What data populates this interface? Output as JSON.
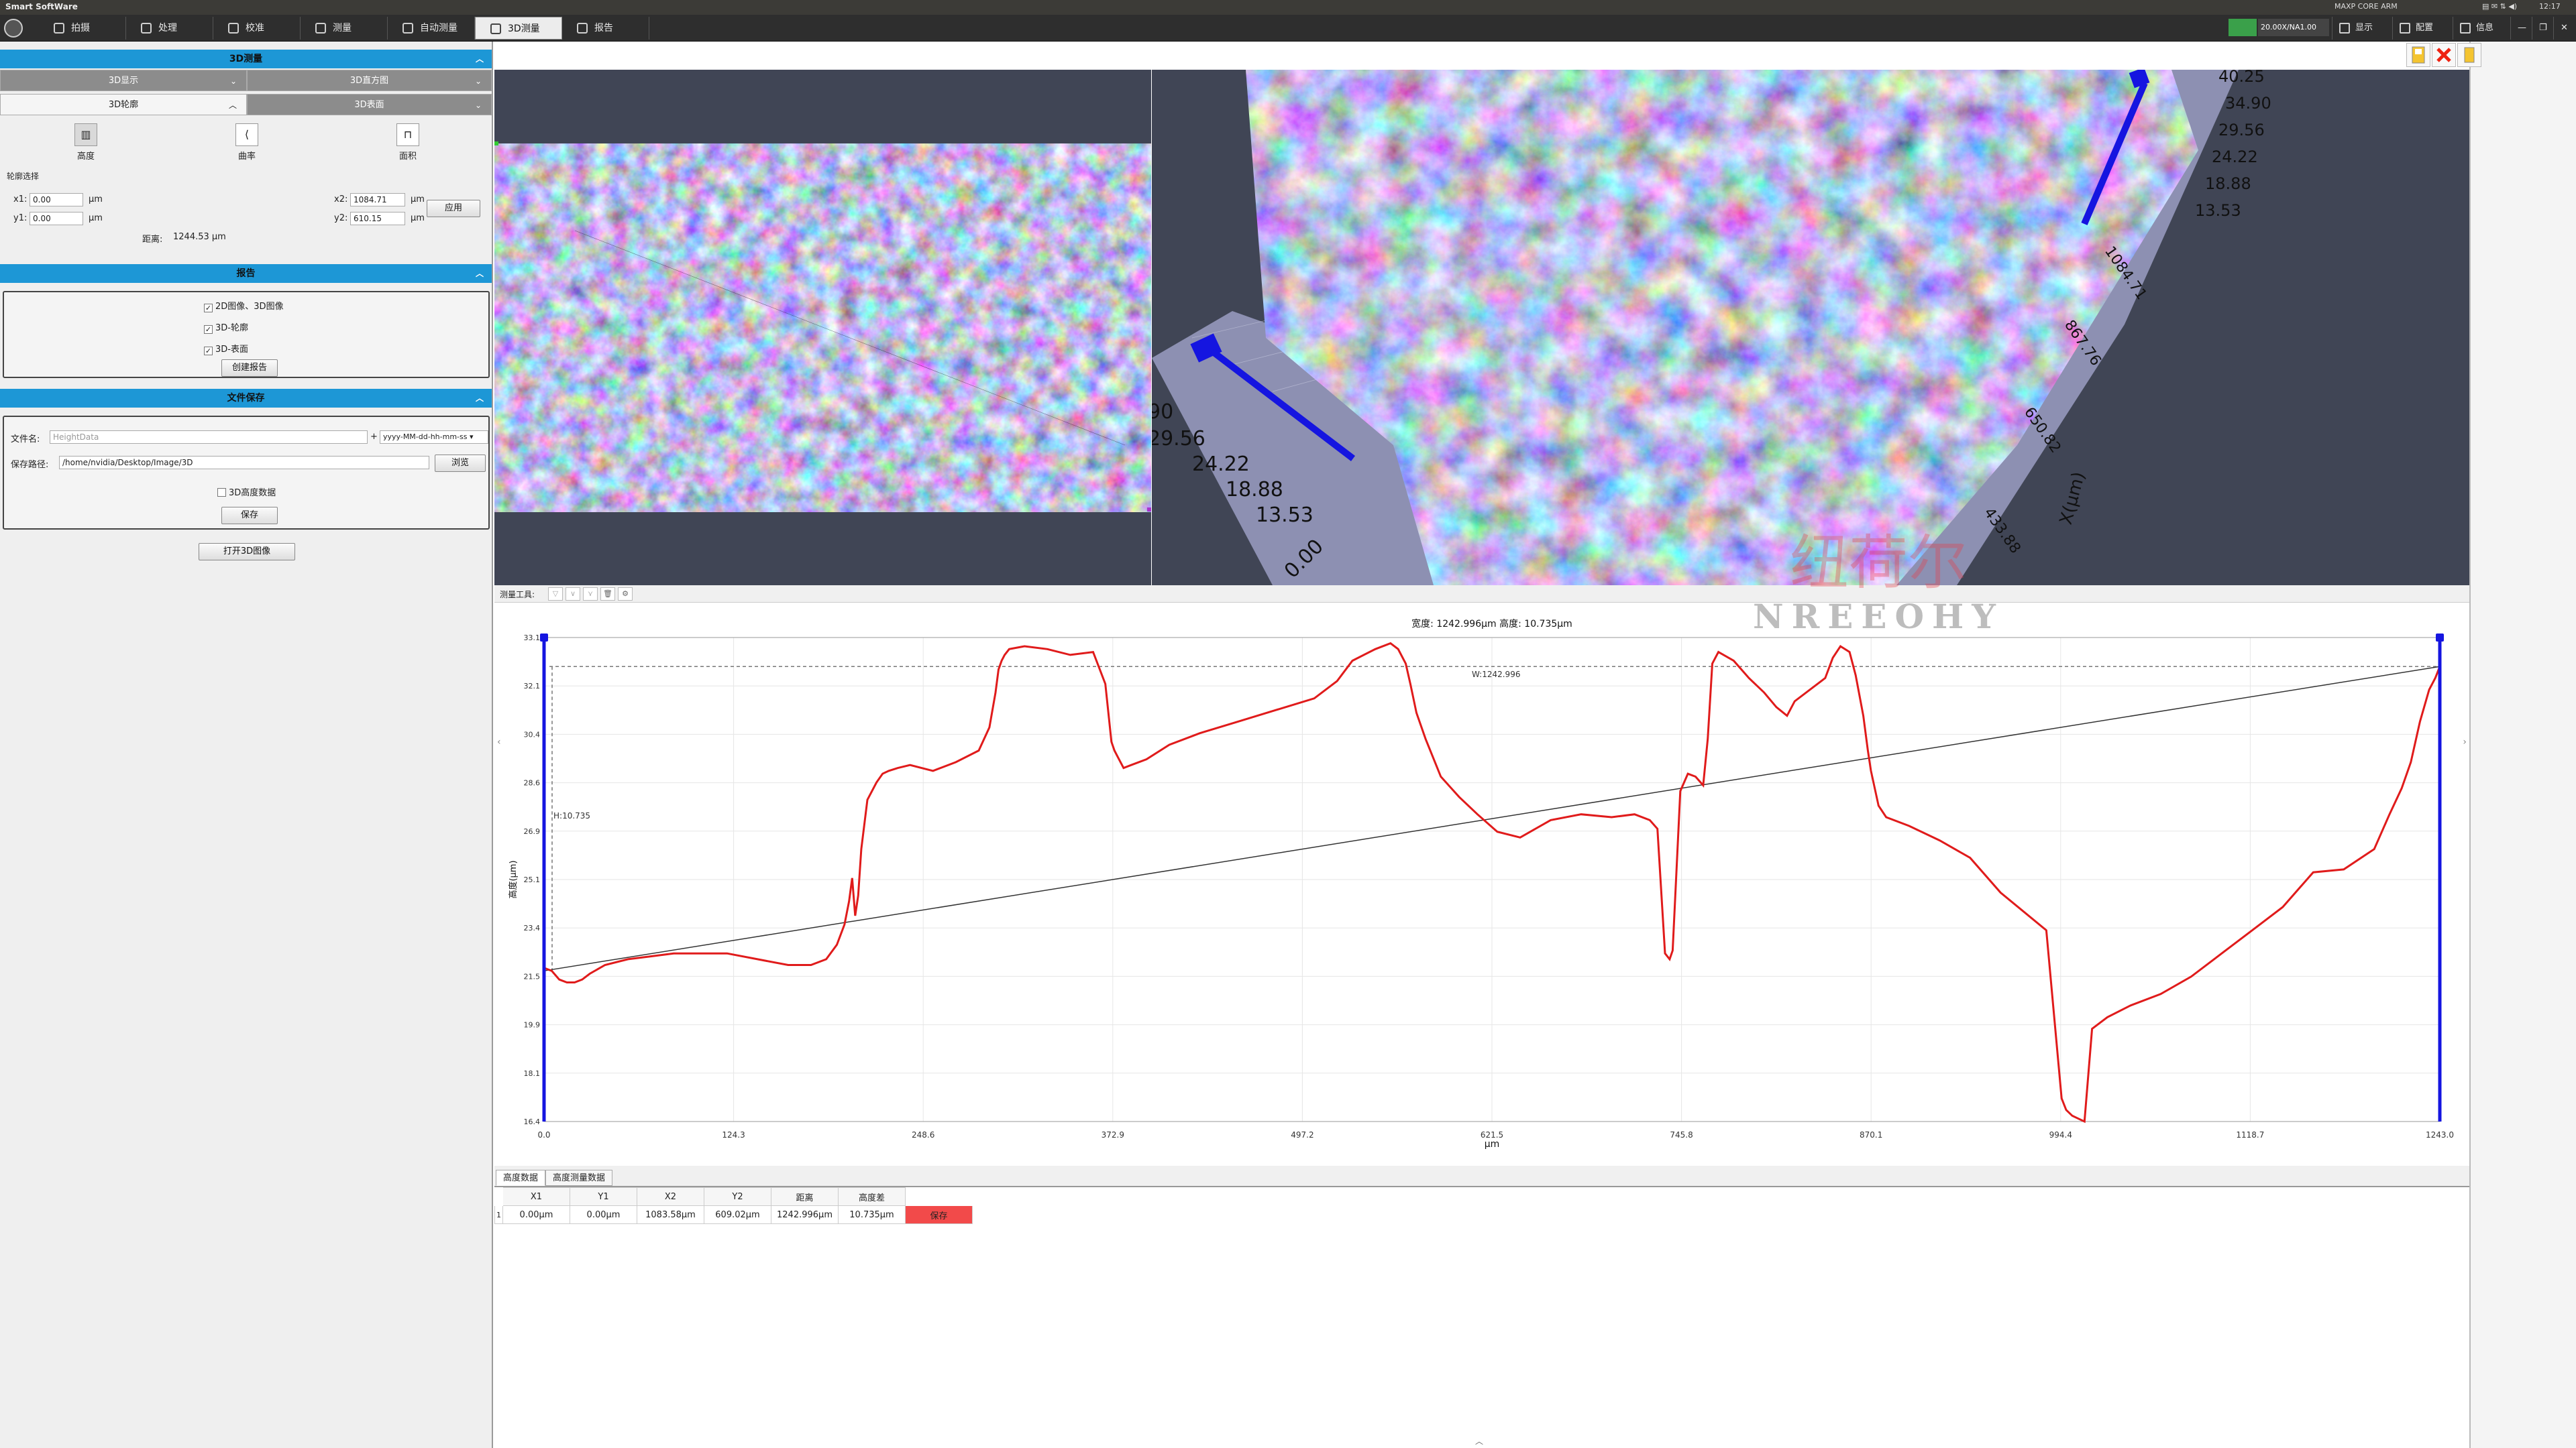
{
  "app_title": "Smart SoftWare",
  "system_tray": {
    "gpu_label": "MAXP CORE ARM",
    "clock": "12:17"
  },
  "toolbar": {
    "tabs": [
      {
        "label": "拍摄",
        "icon": "camera-icon"
      },
      {
        "label": "处理",
        "icon": "image-process-icon"
      },
      {
        "label": "校准",
        "icon": "ruler-icon"
      },
      {
        "label": "测量",
        "icon": "measure-icon"
      },
      {
        "label": "自动测量",
        "icon": "auto-measure-icon"
      },
      {
        "label": "3D测量",
        "icon": "cube-icon"
      },
      {
        "label": "报告",
        "icon": "report-icon"
      }
    ],
    "active_tab": "3D测量",
    "magnification": "20.00X/NA1.00",
    "right": [
      {
        "label": "显示",
        "icon": "monitor-icon"
      },
      {
        "label": "配置",
        "icon": "gear-icon"
      },
      {
        "label": "信息",
        "icon": "info-icon"
      }
    ],
    "window_buttons": [
      "—",
      "❐",
      "✕"
    ]
  },
  "left_panel": {
    "section_3d": {
      "title": "3D测量",
      "subtabs": [
        {
          "label": "3D显示"
        },
        {
          "label": "3D直方图"
        },
        {
          "label": "3D轮廓"
        },
        {
          "label": "3D表面"
        }
      ],
      "tools": [
        {
          "label": "高度",
          "icon": "height-icon"
        },
        {
          "label": "曲率",
          "icon": "curvature-icon"
        },
        {
          "label": "面积",
          "icon": "area-icon"
        }
      ],
      "profile_select_label": "轮廓选择",
      "x1_label": "x1:",
      "x1": "0.00",
      "y1_label": "y1:",
      "y1": "0.00",
      "x2_label": "x2:",
      "x2": "1084.71",
      "y2_label": "y2:",
      "y2": "610.15",
      "unit": "μm",
      "apply": "应用",
      "distance_label": "距离:",
      "distance": "1244.53  μm"
    },
    "report": {
      "title": "报告",
      "options": [
        {
          "label": "2D图像、3D图像",
          "checked": true
        },
        {
          "label": "3D-轮廓",
          "checked": true
        },
        {
          "label": "3D-表面",
          "checked": true
        }
      ],
      "create_button": "创建报告"
    },
    "file_save": {
      "title": "文件保存",
      "filename_label": "文件名:",
      "filename_placeholder": "HeightData",
      "date_format": "yyyy-MM-dd-hh-mm-ss",
      "path_label": "保存路径:",
      "path": "/home/nvidia/Desktop/Image/3D",
      "browse": "浏览",
      "height_data_option": {
        "label": "3D高度数据",
        "checked": false
      },
      "save_button": "保存"
    },
    "open_3d_button": "打开3D图像"
  },
  "view3d_labels": {
    "z_right": [
      "40.25",
      "34.90",
      "29.56",
      "24.22",
      "18.88",
      "13.53"
    ],
    "z_left": [
      "90",
      "29.56",
      "24.22",
      "18.88",
      "13.53"
    ],
    "x_ticks": [
      "1084.71",
      "867.76",
      "650.82",
      "433.88"
    ],
    "x_axis": "X(μm)",
    "origin": "0.00"
  },
  "measure_tools": {
    "label": "测量工具:"
  },
  "watermark": {
    "cn": "纽荷尔",
    "en": "NREEOHY"
  },
  "chart_data": {
    "type": "line",
    "title": "宽度: 1242.996μm 高度: 10.735μm",
    "xlabel": "μm",
    "ylabel": "高度(μm)",
    "xlim": [
      0,
      1243
    ],
    "ylim": [
      16.4,
      33.1
    ],
    "x_ticks": [
      "0.0",
      "124.3",
      "248.6",
      "372.9",
      "497.2",
      "621.5",
      "745.8",
      "870.1",
      "994.4",
      "1118.7",
      "1243.0"
    ],
    "y_ticks": [
      "16.4",
      "18.1",
      "19.9",
      "21.5",
      "23.4",
      "25.1",
      "26.9",
      "28.6",
      "30.4",
      "32.1",
      "33.1"
    ],
    "grid": true,
    "annotations": {
      "width_label": "W:1242.996",
      "height_label": "H:10.735"
    },
    "reference_line": {
      "x": [
        0,
        1243
      ],
      "y": [
        21.6,
        32.1
      ]
    },
    "top_dashed_y": 32.1,
    "series": [
      {
        "x": [
          0,
          5,
          10,
          15,
          20,
          25,
          30,
          40,
          55,
          70,
          85,
          100,
          120,
          140,
          160,
          175,
          185,
          192,
          197,
          200,
          202,
          204,
          206,
          208,
          212,
          218,
          222,
          226,
          232,
          240,
          255,
          270,
          285,
          292,
          296,
          298,
          300,
          302,
          305,
          315,
          330,
          345,
          360,
          368,
          372,
          374,
          376,
          380,
          385,
          395,
          410,
          430,
          455,
          480,
          505,
          520,
          530,
          545,
          555,
          560,
          565,
          568,
          572,
          578,
          588,
          600,
          612,
          625,
          640,
          660,
          680,
          700,
          715,
          725,
          730,
          735,
          738,
          740,
          745,
          750,
          755,
          760,
          763,
          766,
          770,
          780,
          790,
          800,
          808,
          815,
          820,
          830,
          840,
          845,
          850,
          856,
          860,
          865,
          868,
          870,
          875,
          880,
          895,
          915,
          935,
          955,
          985,
          995,
          998,
          1002,
          1006,
          1010,
          1015,
          1025,
          1040,
          1060,
          1080,
          1100,
          1120,
          1140,
          1160,
          1180,
          1200,
          1210,
          1218,
          1224,
          1230,
          1236,
          1240,
          1243
        ],
        "y": [
          21.7,
          21.6,
          21.3,
          21.2,
          21.2,
          21.3,
          21.5,
          21.8,
          22.0,
          22.1,
          22.2,
          22.2,
          22.2,
          22.0,
          21.8,
          21.8,
          22.0,
          22.5,
          23.2,
          24.0,
          24.8,
          23.5,
          24.2,
          25.8,
          27.5,
          28.1,
          28.4,
          28.5,
          28.6,
          28.7,
          28.5,
          28.8,
          29.2,
          30.0,
          31.2,
          32.0,
          32.3,
          32.5,
          32.7,
          32.8,
          32.7,
          32.5,
          32.6,
          31.5,
          29.5,
          29.2,
          29.0,
          28.6,
          28.7,
          28.9,
          29.4,
          29.8,
          30.2,
          30.6,
          31.0,
          31.6,
          32.3,
          32.7,
          32.9,
          32.7,
          32.2,
          31.5,
          30.5,
          29.6,
          28.3,
          27.6,
          27.0,
          26.4,
          26.2,
          26.8,
          27.0,
          26.9,
          27.0,
          26.8,
          26.5,
          22.2,
          22.0,
          22.3,
          27.8,
          28.4,
          28.3,
          28.0,
          29.6,
          32.2,
          32.6,
          32.3,
          31.7,
          31.2,
          30.7,
          30.4,
          30.9,
          31.3,
          31.7,
          32.4,
          32.8,
          32.6,
          31.8,
          30.4,
          29.2,
          28.5,
          27.3,
          26.9,
          26.6,
          26.1,
          25.5,
          24.3,
          23.0,
          17.2,
          16.8,
          16.6,
          16.5,
          16.4,
          19.6,
          20.0,
          20.4,
          20.8,
          21.4,
          22.2,
          23.0,
          23.8,
          25.0,
          25.1,
          25.8,
          27.0,
          27.9,
          28.8,
          30.2,
          31.3,
          31.7,
          32.1
        ]
      }
    ]
  },
  "bottom_tabs": [
    {
      "label": "高度数据"
    },
    {
      "label": "高度测量数据"
    }
  ],
  "table": {
    "headers": [
      "X1",
      "Y1",
      "X2",
      "Y2",
      "距离",
      "高度差"
    ],
    "rows": [
      {
        "index": "1",
        "cells": [
          "0.00μm",
          "0.00μm",
          "1083.58μm",
          "609.02μm",
          "1242.996μm",
          "10.735μm"
        ],
        "action": "保存"
      }
    ]
  },
  "colors": {
    "accent": "#1d97d6",
    "profile": "#e01b1b",
    "marker": "#1515e0"
  }
}
